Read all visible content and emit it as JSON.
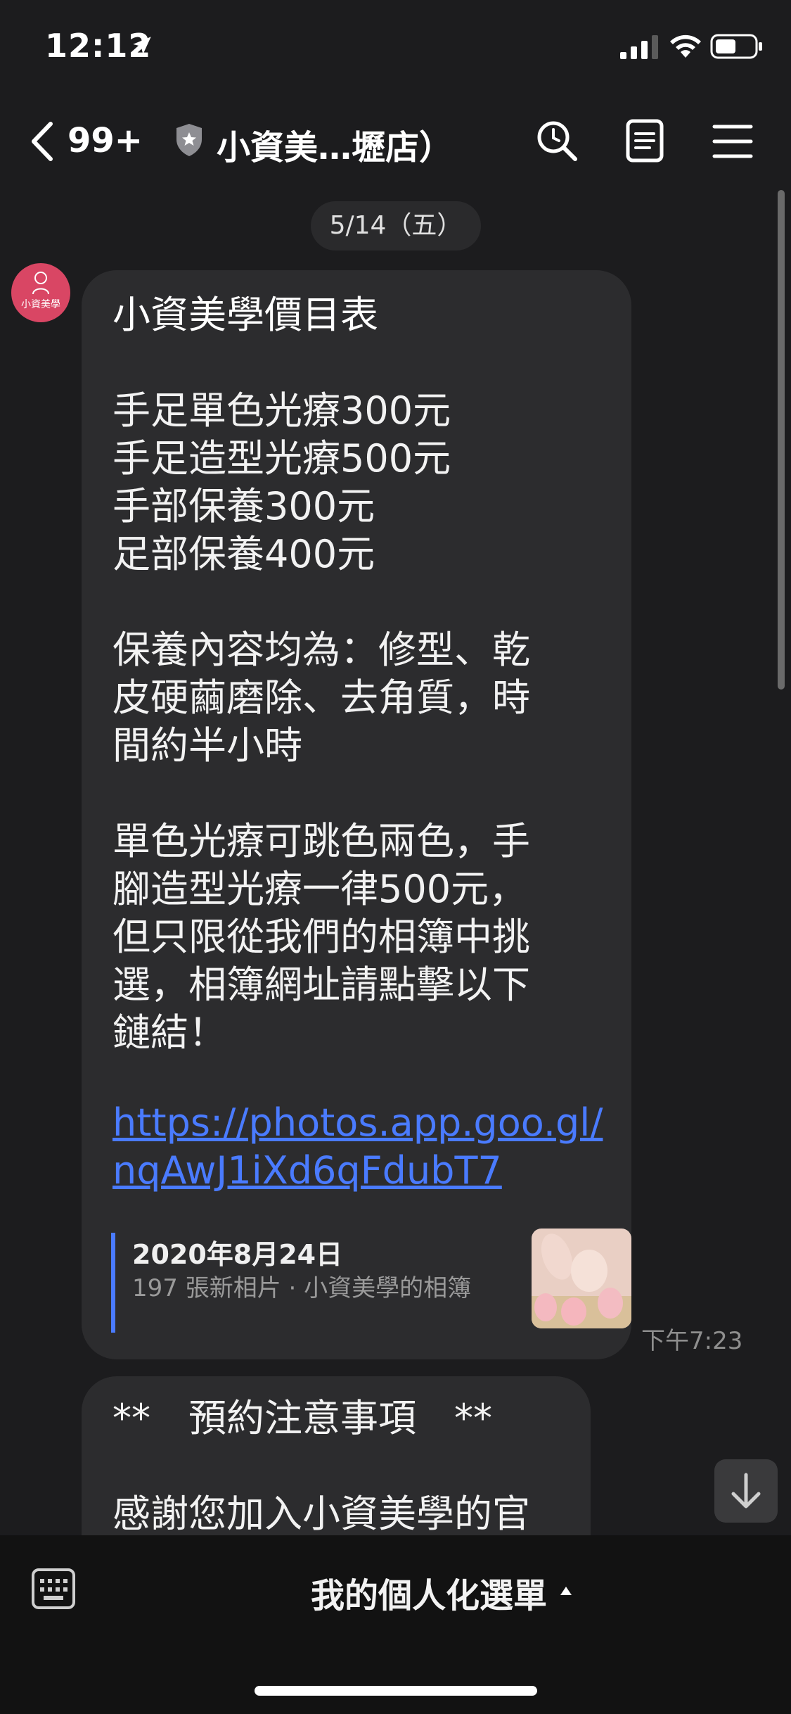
{
  "status_bar": {
    "time": "12:12"
  },
  "header": {
    "back_count": "99+",
    "title": "小資美…壢店）",
    "icons": [
      "search-icon",
      "note-icon",
      "menu-icon"
    ]
  },
  "date_chip": "5/14（五）",
  "avatar": {
    "text": "小資美學"
  },
  "message1": {
    "title": "小資美學價目表",
    "body": "\n\n手足單色光療300元\n手足造型光療500元\n手部保養300元\n足部保養400元\n\n保養內容均為：修型、乾\n皮硬繭磨除、去角質，時\n間約半小時\n\n單色光療可跳色兩色，手\n腳造型光療一律500元，\n但只限從我們的相簿中挑\n選，相簿網址請點擊以下\n鏈結！",
    "link": "https://photos.app.goo.gl/nqAwJ1iXd6qFdubT7",
    "preview": {
      "title": "2020年8月24日",
      "description": "197 張新相片 · 小資美學的相簿"
    },
    "time": "下午7:23"
  },
  "message2": {
    "title": "**　預約注意事項　**",
    "text": "感謝您加入小資美學的官"
  },
  "bottom_bar": {
    "menu_label": "我的個人化選單"
  },
  "colors": {
    "background": "#1c1c1e",
    "bubble": "#2c2c2e",
    "link": "#4a7bff",
    "avatar": "#d94664"
  }
}
